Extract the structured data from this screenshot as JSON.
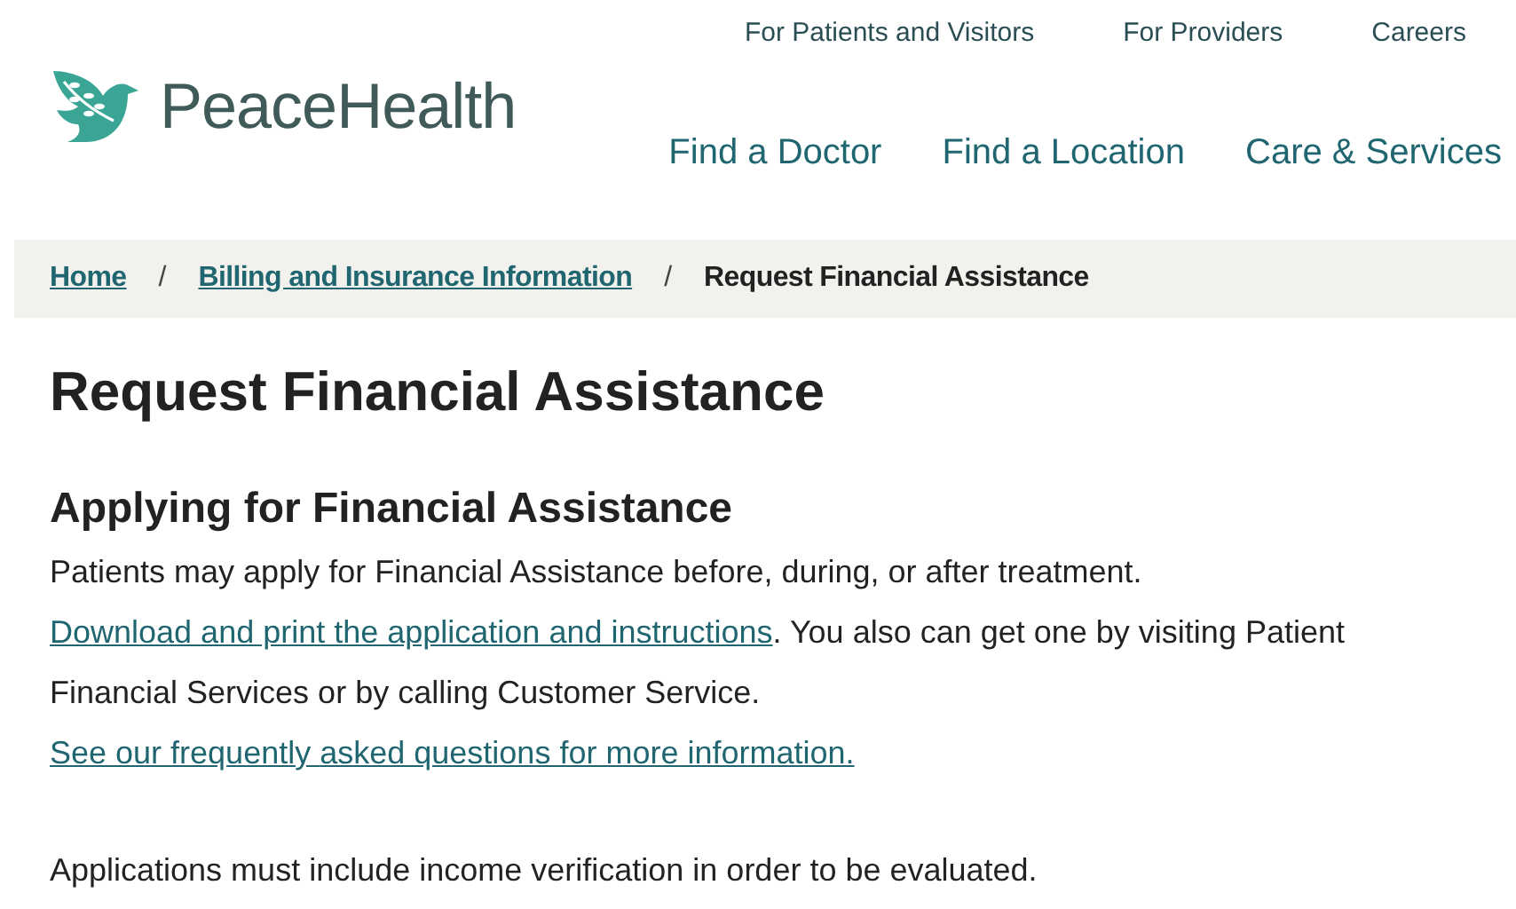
{
  "logo": {
    "text": "PeaceHealth"
  },
  "utility_nav": [
    {
      "label": "For Patients and Visitors"
    },
    {
      "label": "For Providers"
    },
    {
      "label": "Careers"
    }
  ],
  "main_nav": [
    {
      "label": "Find a Doctor"
    },
    {
      "label": "Find a Location"
    },
    {
      "label": "Care & Services"
    }
  ],
  "breadcrumb": {
    "separator": "/",
    "items": [
      {
        "label": "Home",
        "kind": "link"
      },
      {
        "label": "Billing and Insurance Information",
        "kind": "link"
      },
      {
        "label": "Request Financial Assistance",
        "kind": "current"
      }
    ]
  },
  "page_title": "Request Financial Assistance",
  "section_title": "Applying for Financial Assistance",
  "paragraph": [
    {
      "kind": "text",
      "text": "Patients may apply for Financial Assistance before, during, or after treatment. "
    },
    {
      "kind": "link",
      "text": "Download and print the application and instructions"
    },
    {
      "kind": "text",
      "text": ". You also can get one by visiting Patient Financial Services or by calling Customer Service. "
    },
    {
      "kind": "link",
      "text": "See our frequently "
    },
    {
      "kind": "link",
      "text": "asked questions for more information."
    }
  ],
  "note": "Applications must include income verification in order to be evaluated."
}
